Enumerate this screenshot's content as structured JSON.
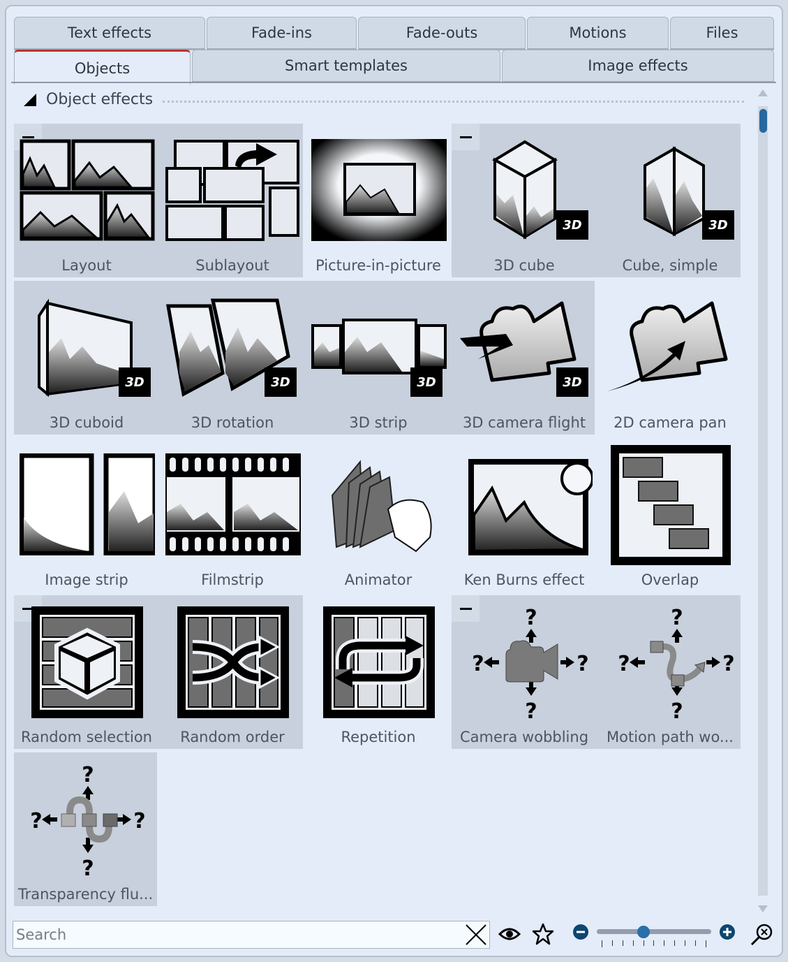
{
  "tabs_row1": [
    {
      "label": "Text effects",
      "active": false
    },
    {
      "label": "Fade-ins",
      "active": false
    },
    {
      "label": "Fade-outs",
      "active": false
    },
    {
      "label": "Motions",
      "active": false
    },
    {
      "label": "Files",
      "active": false
    }
  ],
  "tabs_row2": [
    {
      "label": "Objects",
      "active": true
    },
    {
      "label": "Smart templates",
      "active": false
    },
    {
      "label": "Image effects",
      "active": false
    }
  ],
  "section": {
    "title": "Object effects",
    "expanded": true
  },
  "effects": [
    {
      "label": "Layout",
      "icon": "layout-icon",
      "badge": ""
    },
    {
      "label": "Sublayout",
      "icon": "sublayout-icon",
      "badge": ""
    },
    {
      "label": "Picture-in-picture",
      "icon": "picture-in-picture-icon",
      "badge": ""
    },
    {
      "label": "3D cube",
      "icon": "3d-cube-icon",
      "badge": "3D"
    },
    {
      "label": "Cube, simple",
      "icon": "cube-simple-icon",
      "badge": "3D"
    },
    {
      "label": "3D cuboid",
      "icon": "3d-cuboid-icon",
      "badge": "3D"
    },
    {
      "label": "3D rotation",
      "icon": "3d-rotation-icon",
      "badge": "3D"
    },
    {
      "label": "3D strip",
      "icon": "3d-strip-icon",
      "badge": "3D"
    },
    {
      "label": "3D camera flight",
      "icon": "camera-flight-icon",
      "badge": "3D"
    },
    {
      "label": "2D camera pan",
      "icon": "camera-pan-icon",
      "badge": ""
    },
    {
      "label": "Image strip",
      "icon": "image-strip-icon",
      "badge": ""
    },
    {
      "label": "Filmstrip",
      "icon": "filmstrip-icon",
      "badge": ""
    },
    {
      "label": "Animator",
      "icon": "animator-icon",
      "badge": ""
    },
    {
      "label": "Ken Burns effect",
      "icon": "ken-burns-icon",
      "badge": ""
    },
    {
      "label": "Overlap",
      "icon": "overlap-icon",
      "badge": ""
    },
    {
      "label": "Random selection",
      "icon": "dice-icon",
      "badge": ""
    },
    {
      "label": "Random order",
      "icon": "shuffle-icon",
      "badge": ""
    },
    {
      "label": "Repetition",
      "icon": "repeat-icon",
      "badge": ""
    },
    {
      "label": "Camera wobbling",
      "icon": "camera-wobble-icon",
      "badge": ""
    },
    {
      "label": "Motion path wo...",
      "icon": "motion-path-wobble-icon",
      "badge": ""
    },
    {
      "label": "Transparency flu...",
      "icon": "transparency-fluctuation-icon",
      "badge": ""
    }
  ],
  "search": {
    "placeholder": "Search",
    "value": ""
  },
  "toolbar": {
    "clear": "close-icon",
    "preview": "eye-icon",
    "favorite": "star-icon",
    "zoom_out": "minus-circle-icon",
    "zoom_in": "plus-circle-icon",
    "fit": "zoom-fit-icon"
  },
  "zoom_slider": {
    "value_fraction": 0.4,
    "ticks": 11
  },
  "colors": {
    "accent_active_tab": "#b8323a",
    "scroll_thumb": "#2668a0",
    "group_bg": "#c7d0dc",
    "panel_bg": "#e3ecf8"
  }
}
